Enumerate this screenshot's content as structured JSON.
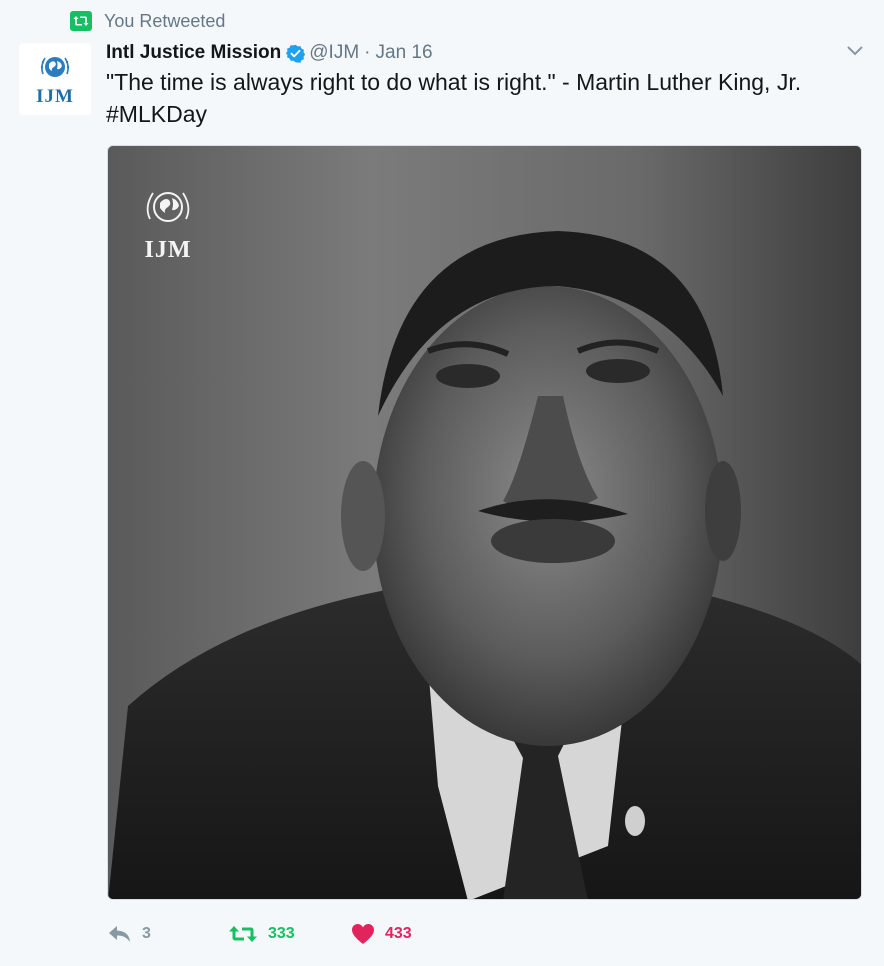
{
  "context": {
    "label": "You Retweeted",
    "icon": "retweet-icon",
    "color": "#17bf63"
  },
  "tweet": {
    "author": {
      "name": "Intl Justice Mission",
      "handle": "@IJM",
      "verified": true,
      "avatar_text": "IJM"
    },
    "date": "Jan 16",
    "separator": "·",
    "text": "\"The time is always right to do what is right.\" - Martin Luther King, Jr.",
    "hashtag": "#MLKDay",
    "media": {
      "watermark_text": "IJM"
    }
  },
  "actions": {
    "reply": {
      "icon": "reply-icon",
      "count": "3"
    },
    "retweet": {
      "icon": "retweet-icon",
      "count": "333",
      "active": true
    },
    "like": {
      "icon": "heart-icon",
      "count": "433",
      "active": true
    }
  },
  "colors": {
    "accent": "#1da1f2",
    "retweet": "#17bf63",
    "like": "#e0245e",
    "muted": "#657786"
  }
}
